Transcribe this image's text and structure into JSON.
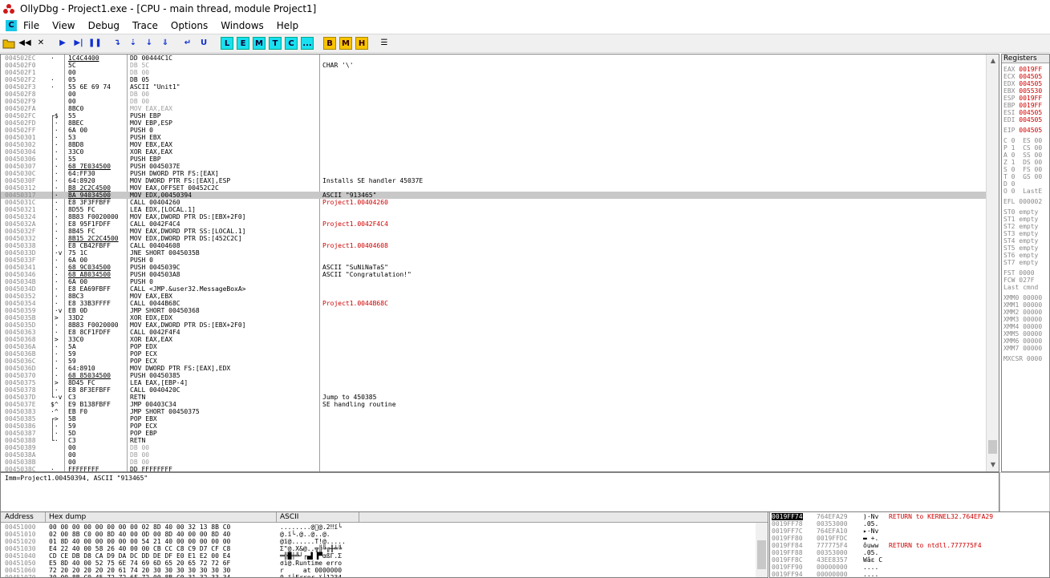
{
  "window": {
    "title": "OllyDbg - Project1.exe - [CPU - main thread, module Project1]"
  },
  "menu": {
    "items": [
      "File",
      "View",
      "Debug",
      "Trace",
      "Options",
      "Windows",
      "Help"
    ],
    "icon_letter": "C"
  },
  "toolbar": {
    "letter_buttons": [
      "L",
      "E",
      "M",
      "T",
      "C",
      "..."
    ],
    "bookmark_buttons": [
      "B",
      "M",
      "H"
    ]
  },
  "disasm": {
    "rows": [
      {
        "addr": "004502EC",
        "mk": "·",
        "hex": "1C4C4400",
        "dis": "DD 00444C1C",
        "cmt": "",
        "hex_ul": true
      },
      {
        "addr": "004502F0",
        "mk": "",
        "hex": "5C",
        "dis": "DB 5C",
        "cmt": "CHAR '\\'",
        "gray": true
      },
      {
        "addr": "004502F1",
        "mk": "",
        "hex": "00",
        "dis": "DB 00",
        "cmt": "",
        "gray": true
      },
      {
        "addr": "004502F2",
        "mk": "·",
        "hex": "05",
        "dis": "DB 05",
        "cmt": ""
      },
      {
        "addr": "004502F3",
        "mk": "·",
        "hex": "55 6E 69 74",
        "dis": "ASCII \"Unit1\"",
        "cmt": ""
      },
      {
        "addr": "004502F8",
        "mk": "",
        "hex": "00",
        "dis": "DB 00",
        "cmt": "",
        "gray": true
      },
      {
        "addr": "004502F9",
        "mk": "",
        "hex": "00",
        "dis": "DB 00",
        "cmt": "",
        "gray": true
      },
      {
        "addr": "004502FA",
        "mk": "",
        "hex": "8BC0",
        "dis": "MOV EAX,EAX",
        "cmt": "",
        "gray": true
      },
      {
        "addr": "004502FC",
        "mk": "┌$",
        "hex": "55",
        "dis": "PUSH EBP",
        "cmt": ""
      },
      {
        "addr": "004502FD",
        "mk": "│·",
        "hex": "8BEC",
        "dis": "MOV EBP,ESP",
        "cmt": ""
      },
      {
        "addr": "004502FF",
        "mk": "│·",
        "hex": "6A 00",
        "dis": "PUSH 0",
        "cmt": ""
      },
      {
        "addr": "00450301",
        "mk": "│·",
        "hex": "53",
        "dis": "PUSH EBX",
        "cmt": ""
      },
      {
        "addr": "00450302",
        "mk": "│·",
        "hex": "8BD8",
        "dis": "MOV EBX,EAX",
        "cmt": ""
      },
      {
        "addr": "00450304",
        "mk": "│·",
        "hex": "33C0",
        "dis": "XOR EAX,EAX",
        "cmt": ""
      },
      {
        "addr": "00450306",
        "mk": "│·",
        "hex": "55",
        "dis": "PUSH EBP",
        "cmt": ""
      },
      {
        "addr": "00450307",
        "mk": "│·",
        "hex": "68 7E034500",
        "dis": "PUSH 0045037E",
        "cmt": "",
        "hex_ul": true
      },
      {
        "addr": "0045030C",
        "mk": "│·",
        "hex": "64:FF30",
        "dis": "PUSH DWORD PTR FS:[EAX]",
        "cmt": ""
      },
      {
        "addr": "0045030F",
        "mk": "│·",
        "hex": "64:8920",
        "dis": "MOV DWORD PTR FS:[EAX],ESP",
        "cmt": "Installs SE handler 45037E"
      },
      {
        "addr": "00450312",
        "mk": "│·",
        "hex": "B8 2C2C4500",
        "dis": "MOV EAX,OFFSET 00452C2C",
        "cmt": "",
        "hex_ul": true
      },
      {
        "addr": "00450317",
        "mk": "│·",
        "hex": "BA 94034500",
        "dis": "MOV EDX,00450394",
        "cmt": "ASCII \"913465\"",
        "sel": true,
        "hex_ul": true
      },
      {
        "addr": "0045031C",
        "mk": "│·",
        "hex": "E8 3F3FFBFF",
        "dis": "CALL 00404260",
        "cmt": "Project1.00404260",
        "cmt_red": true
      },
      {
        "addr": "00450321",
        "mk": "│·",
        "hex": "8D55 FC",
        "dis": "LEA EDX,[LOCAL.1]",
        "cmt": ""
      },
      {
        "addr": "00450324",
        "mk": "│·",
        "hex": "8B83 F0020000",
        "dis": "MOV EAX,DWORD PTR DS:[EBX+2F0]",
        "cmt": ""
      },
      {
        "addr": "0045032A",
        "mk": "│·",
        "hex": "E8 95F1FDFF",
        "dis": "CALL 0042F4C4",
        "cmt": "Project1.0042F4C4",
        "cmt_red": true
      },
      {
        "addr": "0045032F",
        "mk": "│·",
        "hex": "8B45 FC",
        "dis": "MOV EAX,DWORD PTR SS:[LOCAL.1]",
        "cmt": ""
      },
      {
        "addr": "00450332",
        "mk": "│·",
        "hex": "8B15 2C2C4500",
        "dis": "MOV EDX,DWORD PTR DS:[452C2C]",
        "cmt": "",
        "hex_ul": true
      },
      {
        "addr": "00450338",
        "mk": "│·",
        "hex": "E8 CB42FBFF",
        "dis": "CALL 00404608",
        "cmt": "Project1.00404608",
        "cmt_red": true
      },
      {
        "addr": "0045033D",
        "mk": "│·v",
        "hex": "75 1C",
        "dis": "JNE SHORT 0045035B",
        "cmt": ""
      },
      {
        "addr": "0045033F",
        "mk": "│·",
        "hex": "6A 00",
        "dis": "PUSH 0",
        "cmt": ""
      },
      {
        "addr": "00450341",
        "mk": "│·",
        "hex": "68 9C034500",
        "dis": "PUSH 0045039C",
        "cmt": "ASCII \"SuNiNaTaS\"",
        "hex_ul": true
      },
      {
        "addr": "00450346",
        "mk": "│·",
        "hex": "68 A8034500",
        "dis": "PUSH 004503A8",
        "cmt": "ASCII \"Congratulation!\"",
        "hex_ul": true
      },
      {
        "addr": "0045034B",
        "mk": "│·",
        "hex": "6A 00",
        "dis": "PUSH 0",
        "cmt": ""
      },
      {
        "addr": "0045034D",
        "mk": "│·",
        "hex": "E8 EA69FBFF",
        "dis": "CALL <JMP.&user32.MessageBoxA>",
        "cmt": ""
      },
      {
        "addr": "00450352",
        "mk": "│·",
        "hex": "8BC3",
        "dis": "MOV EAX,EBX",
        "cmt": ""
      },
      {
        "addr": "00450354",
        "mk": "│·",
        "hex": "E8 33B3FFFF",
        "dis": "CALL 0044B68C",
        "cmt": "Project1.0044B68C",
        "cmt_red": true
      },
      {
        "addr": "00450359",
        "mk": "│·v",
        "hex": "EB 0D",
        "dis": "JMP SHORT 00450368",
        "cmt": ""
      },
      {
        "addr": "0045035B",
        "mk": "│>",
        "hex": "33D2",
        "dis": "XOR EDX,EDX",
        "cmt": ""
      },
      {
        "addr": "0045035D",
        "mk": "│·",
        "hex": "8B83 F0020000",
        "dis": "MOV EAX,DWORD PTR DS:[EBX+2F0]",
        "cmt": ""
      },
      {
        "addr": "00450363",
        "mk": "│·",
        "hex": "E8 8CF1FDFF",
        "dis": "CALL 0042F4F4",
        "cmt": ""
      },
      {
        "addr": "00450368",
        "mk": "│>",
        "hex": "33C0",
        "dis": "XOR EAX,EAX",
        "cmt": ""
      },
      {
        "addr": "0045036A",
        "mk": "│·",
        "hex": "5A",
        "dis": "POP EDX",
        "cmt": ""
      },
      {
        "addr": "0045036B",
        "mk": "│·",
        "hex": "59",
        "dis": "POP ECX",
        "cmt": ""
      },
      {
        "addr": "0045036C",
        "mk": "│·",
        "hex": "59",
        "dis": "POP ECX",
        "cmt": ""
      },
      {
        "addr": "0045036D",
        "mk": "│·",
        "hex": "64:8910",
        "dis": "MOV DWORD PTR FS:[EAX],EDX",
        "cmt": ""
      },
      {
        "addr": "00450370",
        "mk": "│·",
        "hex": "68 85034500",
        "dis": "PUSH 00450385",
        "cmt": "",
        "hex_ul": true
      },
      {
        "addr": "00450375",
        "mk": "│>",
        "hex": "8D45 FC",
        "dis": "LEA EAX,[EBP-4]",
        "cmt": ""
      },
      {
        "addr": "00450378",
        "mk": "│·",
        "hex": "E8 8F3EFBFF",
        "dis": "CALL 0040420C",
        "cmt": ""
      },
      {
        "addr": "0045037D",
        "mk": "└·v",
        "hex": "C3",
        "dis": "RETN",
        "cmt": "Jump to 450385"
      },
      {
        "addr": "0045037E",
        "mk": "$^",
        "hex": "E9 B138FBFF",
        "dis": "JMP 00403C34",
        "cmt": "SE handling routine"
      },
      {
        "addr": "00450383",
        "mk": "·^",
        "hex": "EB F0",
        "dis": "JMP SHORT 00450375",
        "cmt": ""
      },
      {
        "addr": "00450385",
        "mk": "┌>",
        "hex": "5B",
        "dis": "POP EBX",
        "cmt": ""
      },
      {
        "addr": "00450386",
        "mk": "│·",
        "hex": "59",
        "dis": "POP ECX",
        "cmt": ""
      },
      {
        "addr": "00450387",
        "mk": "│·",
        "hex": "5D",
        "dis": "POP EBP",
        "cmt": ""
      },
      {
        "addr": "00450388",
        "mk": "└·",
        "hex": "C3",
        "dis": "RETN",
        "cmt": ""
      },
      {
        "addr": "00450389",
        "mk": "",
        "hex": "00",
        "dis": "DB 00",
        "cmt": "",
        "gray": true
      },
      {
        "addr": "0045038A",
        "mk": "",
        "hex": "00",
        "dis": "DB 00",
        "cmt": "",
        "gray": true
      },
      {
        "addr": "0045038B",
        "mk": "",
        "hex": "00",
        "dis": "DB 00",
        "cmt": "",
        "gray": true
      },
      {
        "addr": "0045038C",
        "mk": "·",
        "hex": "FFFFFFFF",
        "dis": "DD FFFFFFFF",
        "cmt": ""
      }
    ]
  },
  "registers": {
    "header": "Registers",
    "gp": [
      {
        "n": "EAX",
        "v": "0019FF"
      },
      {
        "n": "ECX",
        "v": "004505"
      },
      {
        "n": "EDX",
        "v": "004505"
      },
      {
        "n": "EBX",
        "v": "005530"
      },
      {
        "n": "ESP",
        "v": "0019FF"
      },
      {
        "n": "EBP",
        "v": "0019FF"
      },
      {
        "n": "ESI",
        "v": "004505"
      },
      {
        "n": "EDI",
        "v": "004505"
      }
    ],
    "eip": {
      "n": "EIP",
      "v": "004505"
    },
    "flags": [
      "C 0  ES 00",
      "P 1  CS 00",
      "A 0  SS 00",
      "Z 1  DS 00",
      "S 0  FS 00",
      "T 0  GS 00",
      "D 0",
      "O 0  LastE"
    ],
    "efl": "EFL 000002",
    "fpu": [
      "ST0 empty",
      "ST1 empty",
      "ST2 empty",
      "ST3 empty",
      "ST4 empty",
      "ST5 empty",
      "ST6 empty",
      "ST7 empty"
    ],
    "fpu_ctl": [
      "FST 0000",
      "FCW 027F",
      "Last cmnd"
    ],
    "xmm": [
      "XMM0 00000",
      "XMM1 00000",
      "XMM2 00000",
      "XMM3 00000",
      "XMM4 00000",
      "XMM5 00000",
      "XMM6 00000",
      "XMM7 00000"
    ],
    "mxcsr": "MXCSR 0000"
  },
  "info": {
    "line": "Imm=Project1.00450394, ASCII \"913465\""
  },
  "dump": {
    "headers": [
      "Address",
      "Hex dump",
      "ASCII"
    ],
    "rows": [
      {
        "a": "00451000",
        "h": "00 00 00 00 00 00 00 00 02 8D 40 00 32 13 8B C0",
        "s": "........@\u0000@.2‼ï└"
      },
      {
        "a": "00451010",
        "h": "02 00 8B C0 00 8D 40 00 0D 00 8D 40 00 00 8D 40",
        "s": "@.ï└.@..@..@."
      },
      {
        "a": "00451020",
        "h": "01 8D 40 00 00 00 00 00 54 21 40 00 00 00 00 00",
        "s": "@ï@......T!@....."
      },
      {
        "a": "00451030",
        "h": "E4 22 40 00 58 26 40 00 00 CB CC C8 C9 D7 CF C8",
        "s": "Σ\"@.X&@..╦╠╚╔╫╧╚"
      },
      {
        "a": "00451040",
        "h": "CD CE DB D8 CA D9 DA DC DD DE DF E0 E1 E2 00 E4",
        "s": "═╬█╪╩┘┌▄▌▐▀αßΓ.Σ"
      },
      {
        "a": "00451050",
        "h": "E5 8D 40 00 52 75 6E 74 69 6D 65 20 65 72 72 6F",
        "s": "σì@.Runtime erro"
      },
      {
        "a": "00451060",
        "h": "72 20 20 20 20 20 61 74 20 30 30 30 30 30 30 30",
        "s": "r     at 0000000"
      },
      {
        "a": "00451070",
        "h": "30 00 8B C0 45 72 72 6F 72 00 8B C0 31 32 33 34",
        "s": "0.ï└Error.ï└1234"
      }
    ]
  },
  "stack": {
    "rows": [
      {
        "a": "0019FF74",
        "v": "764EFA29",
        "t": ")·Nv",
        "c": "RETURN to KERNEL32.764EFA29",
        "sel": true
      },
      {
        "a": "0019FF78",
        "v": "00353000",
        "t": ".05.",
        "c": ""
      },
      {
        "a": "0019FF7C",
        "v": "764EFA10",
        "t": "▸·Nv",
        "c": ""
      },
      {
        "a": "0019FF80",
        "v": "0019FFDC",
        "t": "▬ +.",
        "c": ""
      },
      {
        "a": "0019FF84",
        "v": "777775F4",
        "t": "ôuww",
        "c": "RETURN to ntdll.777775F4"
      },
      {
        "a": "0019FF88",
        "v": "00353000",
        "t": ".05.",
        "c": ""
      },
      {
        "a": "0019FF8C",
        "v": "43EE8357",
        "t": "Wâε C",
        "c": ""
      },
      {
        "a": "0019FF90",
        "v": "00000000",
        "t": "....",
        "c": ""
      },
      {
        "a": "0019FF94",
        "v": "00000000",
        "t": "....",
        "c": ""
      }
    ]
  }
}
